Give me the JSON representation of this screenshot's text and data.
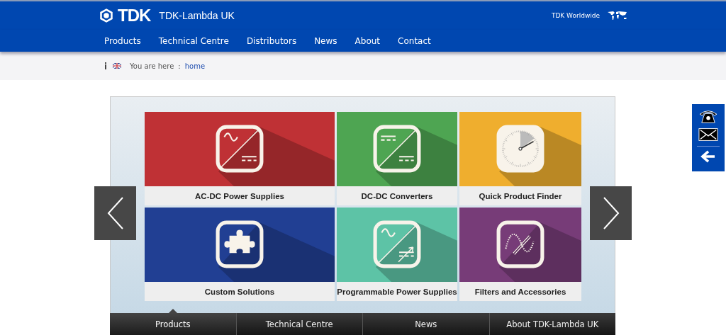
{
  "header": {
    "brand": "TDK",
    "site_name": "TDK-Lambda UK",
    "worldwide_link": "TDK Worldwide"
  },
  "nav": [
    {
      "label": "Products"
    },
    {
      "label": "Technical Centre"
    },
    {
      "label": "Distributors"
    },
    {
      "label": "News"
    },
    {
      "label": "About"
    },
    {
      "label": "Contact"
    }
  ],
  "breadcrumb": {
    "prefix": "You are here",
    "separator": ":",
    "current": "home"
  },
  "tiles": [
    {
      "label": "AC-DC Power Supplies",
      "color": "#bf3135",
      "kind": "acdc"
    },
    {
      "label": "DC-DC Converters",
      "color": "#4ea552",
      "kind": "dcdc"
    },
    {
      "label": "Quick Product Finder",
      "color": "#efae2e",
      "kind": "dial"
    },
    {
      "label": "Custom Solutions",
      "color": "#213f93",
      "kind": "puzzle"
    },
    {
      "label": "Programmable Power Supplies",
      "color": "#5dc3a6",
      "kind": "programmable"
    },
    {
      "label": "Filters and Accessories",
      "color": "#773c78",
      "kind": "filter"
    }
  ],
  "slider_tabs": [
    {
      "label": "Products",
      "selected": true
    },
    {
      "label": "Technical Centre",
      "selected": false
    },
    {
      "label": "News",
      "selected": false
    },
    {
      "label": "About TDK-Lambda UK",
      "selected": false
    }
  ]
}
